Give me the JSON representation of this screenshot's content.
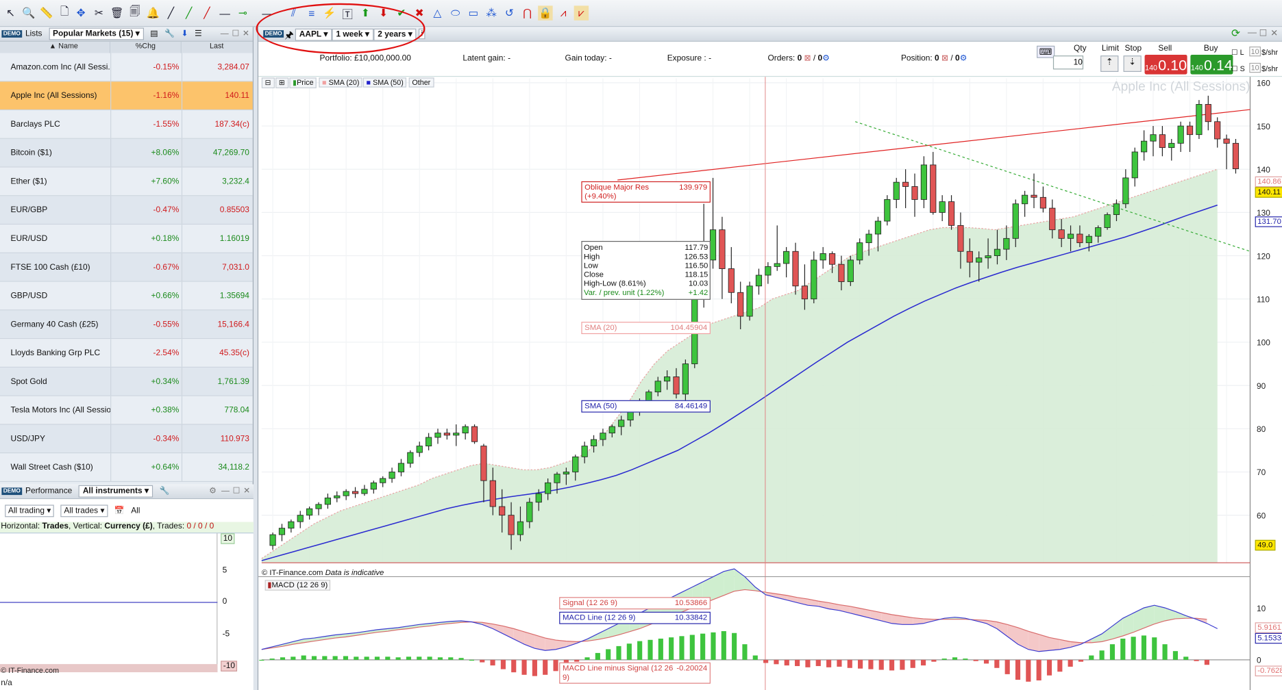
{
  "toolbar": {
    "tools": [
      "pointer-icon",
      "zoom-icon",
      "ruler-icon",
      "move-icon",
      "settings-icon",
      "trash-icon",
      "bell-icon",
      "line-icon",
      "line-icon",
      "hline-icon",
      "line-end-icon"
    ]
  },
  "lists_panel": {
    "tab_lists": "Lists",
    "list_select": "Popular Markets (15)",
    "columns": [
      "Name",
      "%Chg",
      "Last"
    ],
    "rows": [
      {
        "name": "Amazon.com Inc (All Sessi...",
        "chg": "-0.15%",
        "last": "3,284.07",
        "dir": "neg"
      },
      {
        "name": "Apple Inc (All Sessions)",
        "chg": "-1.16%",
        "last": "140.11",
        "dir": "neg",
        "selected": true
      },
      {
        "name": "Barclays PLC",
        "chg": "-1.55%",
        "last": "187.34(c)",
        "dir": "neg"
      },
      {
        "name": "Bitcoin ($1)",
        "chg": "+8.06%",
        "last": "47,269.70",
        "dir": "pos"
      },
      {
        "name": "Ether ($1)",
        "chg": "+7.60%",
        "last": "3,232.4",
        "dir": "pos"
      },
      {
        "name": "EUR/GBP",
        "chg": "-0.47%",
        "last": "0.85503",
        "dir": "neg"
      },
      {
        "name": "EUR/USD",
        "chg": "+0.18%",
        "last": "1.16019",
        "dir": "pos"
      },
      {
        "name": "FTSE 100 Cash (£10)",
        "chg": "-0.67%",
        "last": "7,031.0",
        "dir": "neg"
      },
      {
        "name": "GBP/USD",
        "chg": "+0.66%",
        "last": "1.35694",
        "dir": "pos"
      },
      {
        "name": "Germany 40 Cash (£25)",
        "chg": "-0.55%",
        "last": "15,166.4",
        "dir": "neg"
      },
      {
        "name": "Lloyds Banking Grp PLC",
        "chg": "-2.54%",
        "last": "45.35(c)",
        "dir": "neg"
      },
      {
        "name": "Spot Gold",
        "chg": "+0.34%",
        "last": "1,761.39",
        "dir": "pos"
      },
      {
        "name": "Tesla Motors Inc (All Sessio...",
        "chg": "+0.38%",
        "last": "778.04",
        "dir": "pos"
      },
      {
        "name": "USD/JPY",
        "chg": "-0.34%",
        "last": "110.973",
        "dir": "neg"
      },
      {
        "name": "Wall Street Cash ($10)",
        "chg": "+0.64%",
        "last": "34,118.2",
        "dir": "pos"
      }
    ]
  },
  "perf_panel": {
    "tab": "Performance",
    "select": "All instruments",
    "filter1": "All trading",
    "filter2": "All trades",
    "filter3": "All",
    "caption_pre": "Horizontal: ",
    "caption_h": "Trades",
    "caption_mid": ", Vertical: ",
    "caption_v": "Currency (£)",
    "caption_post": ", Trades: ",
    "caption_trades": "0 / 0 / 0",
    "axis": [
      "10",
      "5",
      "0",
      "-5",
      "-10"
    ],
    "footer": "© IT-Finance.com",
    "bottom": "n/a"
  },
  "chart_toolbar": {
    "symbol": "AAPL",
    "period": "1 week",
    "range": "2 years"
  },
  "portfolio": {
    "portfolio_label": "Portfolio:",
    "portfolio_value": "£10,000,000.00",
    "latent_label": "Latent gain:",
    "latent_value": "-",
    "gain_label": "Gain today:",
    "gain_value": "-",
    "exposure_label": "Exposure :",
    "exposure_value": "-",
    "orders_label": "Orders:",
    "orders_value": "0",
    "orders_value2": "0",
    "position_label": "Position:",
    "position_value": "0",
    "position_value2": "0"
  },
  "trade": {
    "qty_label": "Qty",
    "qty": "10",
    "limit_label": "Limit",
    "stop_label": "Stop",
    "sell_label": "Sell",
    "buy_label": "Buy",
    "sell_small": "140",
    "sell_big": "0.10",
    "buy_small": "140",
    "buy_big": "0.14",
    "l_label": "L",
    "s_label": "S",
    "unit1": "$/shr",
    "unit2": "$/shr",
    "qty_l": "10",
    "qty_s": "10"
  },
  "chart_legend": {
    "price": "Price",
    "sma20": "SMA (20)",
    "sma50": "SMA (50)",
    "other": "Other"
  },
  "chart_title": "Apple Inc (All Sessions)",
  "credit": "© IT-Finance.com",
  "credit_note": "Data is indicative",
  "annotations": {
    "oblique_label": "Oblique Major Res (+9.40%)",
    "oblique_value": "139.979",
    "sma20_label": "SMA (20)",
    "sma20_value": "104.45904",
    "sma50_label": "SMA (50)",
    "sma50_value": "84.46149",
    "signal_label": "Signal (12 26 9)",
    "signal_value": "10.53866",
    "macd_label": "MACD Line (12 26 9)",
    "macd_value": "10.33842",
    "hist_label": "MACD Line minus Signal (12 26 9)",
    "hist_value": "-0.20024",
    "price_tags": {
      "p1": "140.86",
      "p2": "140.11",
      "p3": "131.70",
      "p4": "49.0",
      "m1": "5.9161",
      "m2": "5.1533",
      "m3": "-0.7628"
    }
  },
  "ohlc_box": {
    "rows": [
      {
        "k": "Open",
        "v": "117.79"
      },
      {
        "k": "High",
        "v": "126.53"
      },
      {
        "k": "Low",
        "v": "116.50"
      },
      {
        "k": "Close",
        "v": "118.15"
      },
      {
        "k": "High-Low (8.61%)",
        "v": "10.03"
      },
      {
        "k": "Var. / prev. unit (1.22%)",
        "v": "+1.42"
      }
    ]
  },
  "macd_title": "MACD (12 26 9)",
  "y_axis": [
    "160",
    "150",
    "140",
    "130",
    "120",
    "110",
    "100",
    "90",
    "80",
    "70",
    "60"
  ],
  "macd_axis": [
    "10",
    "0"
  ],
  "chart_data": {
    "type": "candlestick",
    "title": "Apple Inc (All Sessions)",
    "ylim": [
      49,
      160
    ],
    "candles": [
      [
        53,
        56,
        52,
        55.5
      ],
      [
        55.5,
        58,
        54,
        57
      ],
      [
        57,
        59,
        56,
        58.5
      ],
      [
        58.5,
        61,
        57,
        60
      ],
      [
        60,
        62,
        59,
        61.5
      ],
      [
        61.5,
        63,
        60,
        62.5
      ],
      [
        62.5,
        65,
        61.5,
        64
      ],
      [
        64,
        65.5,
        63,
        64.5
      ],
      [
        64.5,
        66,
        63.5,
        65.5
      ],
      [
        65.5,
        66.5,
        64,
        65
      ],
      [
        65,
        67,
        64.5,
        66
      ],
      [
        66,
        68,
        65,
        67.5
      ],
      [
        67.5,
        69,
        66.5,
        68.5
      ],
      [
        68.5,
        71,
        67.5,
        70
      ],
      [
        70,
        73,
        69,
        72
      ],
      [
        72,
        75,
        71,
        74.5
      ],
      [
        74.5,
        77,
        73.5,
        76
      ],
      [
        76,
        79,
        75,
        78
      ],
      [
        78,
        80,
        76.5,
        79
      ],
      [
        79,
        80,
        77.5,
        78.5
      ],
      [
        78.5,
        81,
        76,
        79
      ],
      [
        79,
        81,
        77.5,
        80.5
      ],
      [
        80.5,
        81,
        76.5,
        77
      ],
      [
        76,
        76.5,
        63,
        68
      ],
      [
        68,
        71,
        60,
        62
      ],
      [
        62,
        66,
        56,
        60
      ],
      [
        60,
        63,
        52,
        55.5
      ],
      [
        55.5,
        62,
        54,
        58.5
      ],
      [
        58.5,
        64,
        57,
        63
      ],
      [
        63,
        66,
        61,
        65
      ],
      [
        65,
        68.5,
        63.5,
        67.5
      ],
      [
        67.5,
        70,
        65,
        69.5
      ],
      [
        69.5,
        71,
        67,
        70
      ],
      [
        70,
        74,
        68,
        73.5
      ],
      [
        73.5,
        77,
        72,
        76
      ],
      [
        76,
        78.5,
        74.5,
        77.5
      ],
      [
        77.5,
        80,
        76,
        79
      ],
      [
        79,
        81,
        78,
        80.5
      ],
      [
        80.5,
        83,
        78.5,
        82
      ],
      [
        82,
        85,
        80.5,
        84
      ],
      [
        84,
        87,
        83,
        86
      ],
      [
        86,
        89,
        85,
        88.5
      ],
      [
        88.5,
        92,
        87.5,
        91
      ],
      [
        91,
        93.5,
        89,
        92
      ],
      [
        92,
        94,
        87,
        88
      ],
      [
        88,
        96,
        86.5,
        95
      ],
      [
        95,
        112,
        94,
        110
      ],
      [
        110,
        132,
        108,
        119
      ],
      [
        119,
        138,
        117,
        126
      ],
      [
        126,
        129,
        110,
        117
      ],
      [
        117,
        122,
        109,
        111.5
      ],
      [
        111.5,
        114,
        103,
        106
      ],
      [
        106,
        114,
        105,
        113
      ],
      [
        113,
        117,
        111,
        115.5
      ],
      [
        115.5,
        118.5,
        113.5,
        117.5
      ],
      [
        117.5,
        127,
        116.5,
        118.2
      ],
      [
        118.2,
        122,
        115,
        121
      ],
      [
        121,
        123,
        111,
        113
      ],
      [
        113,
        118,
        107.5,
        110
      ],
      [
        110,
        121,
        109,
        119
      ],
      [
        119,
        122,
        117,
        120.5
      ],
      [
        120.5,
        121,
        116,
        118
      ],
      [
        118,
        120,
        112,
        114
      ],
      [
        114,
        120,
        113,
        119
      ],
      [
        119,
        124,
        118,
        123
      ],
      [
        123,
        126,
        120,
        125
      ],
      [
        125,
        129,
        121,
        128
      ],
      [
        128,
        134,
        127,
        133
      ],
      [
        133,
        138,
        131,
        137
      ],
      [
        137,
        140,
        131,
        136
      ],
      [
        136,
        139,
        129,
        133
      ],
      [
        133,
        143,
        131,
        141
      ],
      [
        141,
        144,
        129.5,
        130
      ],
      [
        130,
        134,
        128,
        132.5
      ],
      [
        132.5,
        134,
        126,
        127
      ],
      [
        127,
        130,
        117,
        121
      ],
      [
        121,
        124,
        115,
        118.5
      ],
      [
        118.5,
        121,
        114,
        119.5
      ],
      [
        119.5,
        124,
        117,
        120
      ],
      [
        120,
        126,
        118,
        121.5
      ],
      [
        121.5,
        127,
        119,
        124
      ],
      [
        124,
        133,
        122,
        132
      ],
      [
        132,
        135,
        129,
        134
      ],
      [
        134,
        139,
        131,
        133.5
      ],
      [
        133.5,
        136,
        130,
        131
      ],
      [
        131,
        133,
        124,
        126
      ],
      [
        126,
        128.5,
        122,
        124
      ],
      [
        124,
        127,
        121,
        125
      ],
      [
        125,
        127,
        122,
        123
      ],
      [
        123,
        125,
        121,
        124.5
      ],
      [
        124.5,
        127,
        123,
        126.5
      ],
      [
        126.5,
        130,
        126,
        129.5
      ],
      [
        129.5,
        133,
        128,
        132
      ],
      [
        132,
        140,
        131,
        138
      ],
      [
        138,
        145,
        136,
        144
      ],
      [
        144,
        149,
        142,
        146.5
      ],
      [
        146.5,
        150,
        143,
        148
      ],
      [
        148,
        150,
        143,
        145
      ],
      [
        145,
        147,
        142,
        146
      ],
      [
        146,
        151,
        144,
        150
      ],
      [
        150,
        151,
        144,
        148
      ],
      [
        148,
        156,
        147,
        155
      ],
      [
        155,
        157,
        149,
        151
      ],
      [
        151,
        152,
        145,
        147
      ],
      [
        147,
        148,
        140,
        146
      ],
      [
        146,
        147,
        139,
        140.1
      ]
    ],
    "sma20": [
      50,
      52,
      54,
      56,
      58,
      59.5,
      61,
      62,
      63,
      64,
      65,
      66,
      67,
      68.5,
      69.5,
      70.5,
      71.5,
      72,
      71.5,
      71,
      70.5,
      70.5,
      71,
      72,
      73,
      75,
      78,
      82,
      86,
      91,
      95,
      98,
      100,
      102,
      104,
      105,
      106,
      107,
      108,
      110,
      111,
      112,
      114,
      116,
      118,
      120,
      121,
      122,
      123,
      124,
      125,
      126,
      126.5,
      126.5,
      126.5,
      126.3,
      126,
      126.5,
      127,
      127.5,
      128,
      128.5,
      129,
      130,
      131,
      132,
      133,
      134,
      135,
      136,
      137,
      138,
      139,
      140
    ],
    "sma50": [
      49.5,
      50.5,
      51.5,
      52.5,
      53.5,
      54.5,
      55.5,
      56.5,
      57.5,
      58.5,
      59.5,
      60.5,
      61.5,
      62.3,
      63,
      63.6,
      64.2,
      64.7,
      65.2,
      65.8,
      66.5,
      67.3,
      68.2,
      69.2,
      70.5,
      72,
      73.5,
      75,
      77,
      79,
      81.2,
      83.5,
      85.8,
      88.2,
      90.6,
      93,
      95.4,
      97.7,
      100,
      102,
      104,
      106,
      107.8,
      109.5,
      111,
      112.5,
      113.8,
      115,
      116.2,
      117.3,
      118.3,
      119.3,
      120.3,
      121.3,
      122.3,
      123.3,
      124.3,
      125.5,
      126.7,
      128,
      129.3,
      130.5,
      131.7
    ],
    "oblique": {
      "x0": 0.36,
      "y0": 137.5,
      "x1": 1.0,
      "y1": 153.8
    },
    "macd": [
      2,
      2.5,
      3,
      3.5,
      4,
      4.2,
      4.5,
      4.8,
      5,
      5.2,
      5.5,
      5.8,
      6,
      6.2,
      6.5,
      6.8,
      7,
      7.2,
      7.4,
      7.5,
      7.3,
      6.8,
      6,
      5,
      4,
      3,
      2.2,
      1.8,
      2,
      2.5,
      3.2,
      4,
      5,
      6,
      7,
      8,
      9,
      10,
      11,
      12,
      13,
      14,
      15,
      16,
      17,
      17.5,
      16,
      14,
      12.5,
      12,
      11.5,
      11,
      10.5,
      10.3,
      9.8,
      9.5,
      9,
      8.5,
      8,
      7.5,
      7,
      6.8,
      6.8,
      7,
      7.5,
      8,
      8.2,
      8,
      7.5,
      7,
      6,
      4.5,
      3,
      2,
      1.6,
      1.8,
      2,
      2.4,
      3,
      4,
      5,
      6.5,
      8,
      9,
      10,
      10.5,
      10,
      9.3,
      8.5,
      7.8,
      7,
      6
    ],
    "signal": [
      2,
      2.3,
      2.6,
      3,
      3.3,
      3.6,
      3.9,
      4.2,
      4.4,
      4.7,
      5,
      5.3,
      5.5,
      5.8,
      6,
      6.3,
      6.5,
      6.8,
      7,
      7.2,
      7.3,
      7.2,
      6.9,
      6.5,
      6,
      5.4,
      4.8,
      4.2,
      3.8,
      3.6,
      3.5,
      3.6,
      3.9,
      4.3,
      4.8,
      5.4,
      6,
      6.8,
      7.6,
      8.4,
      9.2,
      10,
      10.8,
      11.6,
      12.4,
      13.2,
      13.5,
      13.3,
      13,
      12.7,
      12.4,
      12,
      11.7,
      11.3,
      11,
      10.6,
      10.3,
      9.9,
      9.5,
      9.1,
      8.7,
      8.4,
      8.1,
      7.9,
      7.8,
      7.8,
      7.8,
      7.8,
      7.7,
      7.6,
      7.3,
      6.8,
      6.2,
      5.5,
      4.9,
      4.3,
      3.9,
      3.5,
      3.3,
      3.3,
      3.5,
      4,
      4.6,
      5.3,
      6.1,
      6.9,
      7.5,
      7.9,
      8,
      8,
      7.8
    ],
    "macd_ylim": [
      -6,
      16
    ]
  }
}
